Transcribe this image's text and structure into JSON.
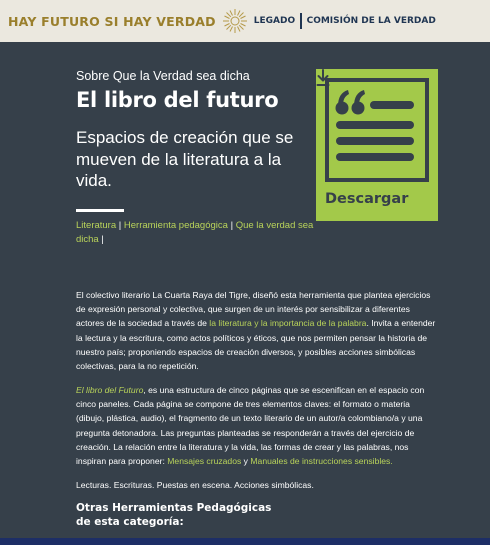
{
  "header": {
    "brand": "HAY FUTURO SI HAY VERDAD",
    "legado": "LEGADO",
    "comision": "COMISIÓN DE LA VERDAD"
  },
  "hero": {
    "pretitle": "Sobre Que la Verdad sea dicha",
    "title": "El libro del futuro",
    "subtitle": "Espacios de creación que se mueven de la literatura a la vida.",
    "tags": [
      "Literatura",
      "Herramienta pedagógica",
      "Que la verdad sea dicha"
    ],
    "separator": "|"
  },
  "download": {
    "label": "Descargar",
    "icon": "download-icon",
    "card_icon": "quote-document-icon"
  },
  "content": {
    "p1_a": "El colectivo literario La Cuarta Raya del Tigre, diseñó esta herramienta que plantea ejercicios de expresión personal y colectiva, que surgen de un interés por sensibilizar a diferentes actores de la sociedad a través de ",
    "p1_link": "la literatura y la importancia de la palabra",
    "p1_b": ". Invita a entender la lectura y la escritura, como actos políticos y éticos, que nos permiten pensar la historia de nuestro país; proponiendo espacios de creación diversos, y posibles acciones simbólicas colectivas, para la no repetición.",
    "p2_title": "El libro del Futuro",
    "p2_a": ", es una estructura de cinco páginas que se escenifican en el espacio con cinco paneles. Cada página se compone de tres elementos claves: el formato o materia (dibujo, plástica, audio), el fragmento de un texto literario de un autor/a colombiano/a y una pregunta detonadora. Las preguntas planteadas se responderán a través del ejercicio de creación. La relación entre la literatura y la vida, las formas de crear y las palabras, nos inspiran para proponer: ",
    "p2_link1": "Mensajes cruzados",
    "p2_and": " y ",
    "p2_link2": "Manuales de instrucciones sensibles.",
    "p3": "Lecturas. Escrituras. Puestas en escena. Acciones simbólicas.",
    "related_heading": "Otras Herramientas Pedagógicas de esta categoría:"
  },
  "colors": {
    "background": "#36404a",
    "accent_green": "#a3c94a",
    "link_green": "#b9d35a",
    "brand_gold": "#9a7f2c",
    "navy": "#1f3552",
    "topbar": "#ebe8df"
  }
}
